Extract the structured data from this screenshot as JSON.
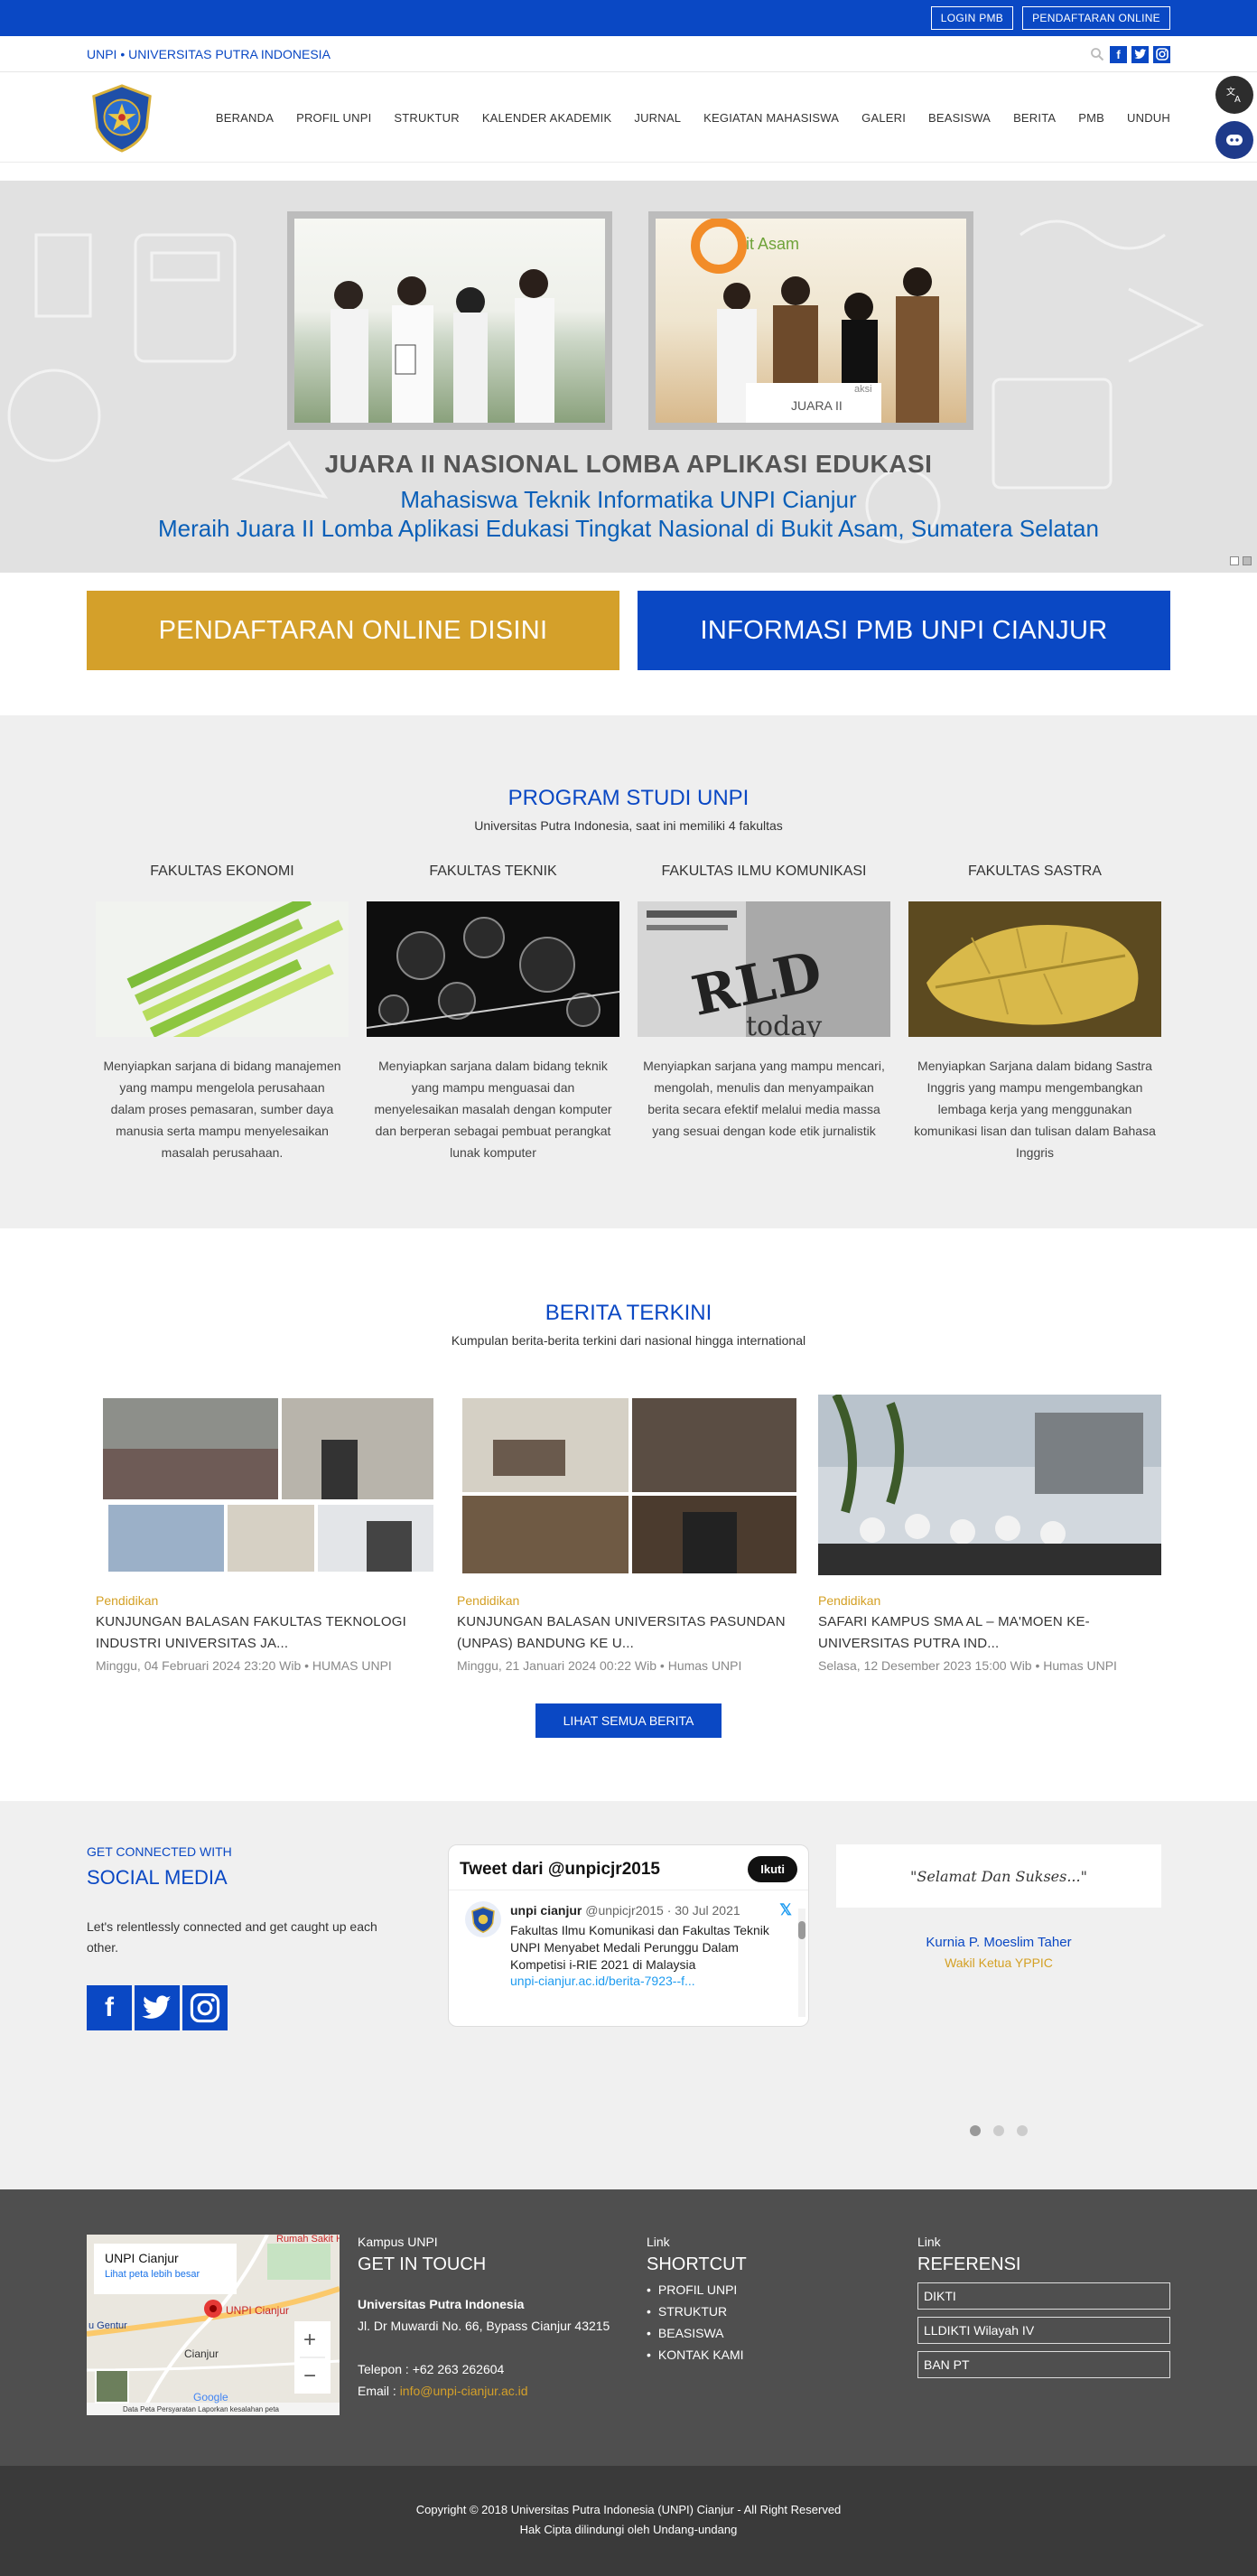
{
  "topbar": {
    "login_label": "LOGIN PMB",
    "register_label": "PENDAFTARAN ONLINE"
  },
  "subheader": {
    "site_tag": "UNPI • UNIVERSITAS PUTRA INDONESIA"
  },
  "nav": {
    "items": [
      "BERANDA",
      "PROFIL UNPI",
      "STRUKTUR",
      "KALENDER AKADEMIK",
      "JURNAL",
      "KEGIATAN MAHASISWA",
      "GALERI",
      "BEASISWA",
      "BERITA",
      "PMB",
      "UNDUH"
    ]
  },
  "hero": {
    "title": "JUARA II NASIONAL LOMBA APLIKASI EDUKASI",
    "line1": "Mahasiswa Teknik Informatika UNPI Cianjur",
    "line2": "Meraih Juara II Lomba Aplikasi Edukasi Tingkat Nasional di Bukit Asam, Sumatera Selatan",
    "banner_text": "JUARA II",
    "banner_brand": "aksi",
    "backdrop_text": "it Asam"
  },
  "cta": {
    "left_label": "PENDAFTARAN ONLINE DISINI",
    "right_label": "INFORMASI PMB UNPI CIANJUR",
    "left_color": "#d4a02a",
    "right_color": "#0a48c4"
  },
  "prodi": {
    "title": "PROGRAM STUDI UNPI",
    "subtitle": "Universitas Putra Indonesia, saat ini memiliki 4 fakultas",
    "faculties": [
      {
        "name": "FAKULTAS EKONOMI",
        "desc": "Menyiapkan sarjana di bidang manajemen yang mampu mengelola perusahaan dalam proses pemasaran, sumber daya manusia serta mampu menyelesaikan masalah perusahaan."
      },
      {
        "name": "FAKULTAS TEKNIK",
        "desc": "Menyiapkan sarjana dalam bidang teknik yang mampu menguasai dan menyelesaikan masalah dengan komputer dan berperan sebagai pembuat perangkat lunak komputer"
      },
      {
        "name": "FAKULTAS ILMU KOMUNIKASI",
        "desc": "Menyiapkan sarjana yang mampu mencari, mengolah, menulis dan menyampaikan berita secara efektif melalui media massa yang sesuai dengan kode etik jurnalistik",
        "image_text": "today"
      },
      {
        "name": "FAKULTAS SASTRA",
        "desc": "Menyiapkan Sarjana dalam bidang Sastra Inggris yang mampu mengembangkan lembaga kerja yang menggunakan komunikasi lisan dan tulisan dalam Bahasa Inggris"
      }
    ]
  },
  "berita": {
    "title": "BERITA TERKINI",
    "subtitle": "Kumpulan berita-berita terkini dari nasional hingga international",
    "items": [
      {
        "category": "Pendidikan",
        "title": "KUNJUNGAN BALASAN FAKULTAS TEKNOLOGI INDUSTRI UNIVERSITAS JA...",
        "meta": "Minggu, 04 Februari 2024 23:20 Wib • HUMAS UNPI"
      },
      {
        "category": "Pendidikan",
        "title": "KUNJUNGAN BALASAN UNIVERSITAS PASUNDAN (UNPAS) BANDUNG KE U...",
        "meta": "Minggu, 21 Januari 2024 00:22 Wib • Humas UNPI"
      },
      {
        "category": "Pendidikan",
        "title": "SAFARI KAMPUS SMA AL – MA'MOEN KE-UNIVERSITAS PUTRA IND...",
        "meta": "Selasa, 12 Desember 2023 15:00 Wib • Humas UNPI"
      }
    ],
    "all_label": "LIHAT SEMUA BERITA"
  },
  "social": {
    "kicker": "GET CONNECTED WITH",
    "title": "SOCIAL MEDIA",
    "text": "Let's relentlessly connected and get caught up each other.",
    "tweet": {
      "header": "Tweet dari @unpicjr2015",
      "follow": "Ikuti",
      "name": "unpi cianjur",
      "handle": "@unpicjr2015 · 30 Jul 2021",
      "text": "Fakultas Ilmu Komunikasi dan Fakultas Teknik UNPI Menyabet Medali Perunggu Dalam Kompetisi i-RIE 2021 di Malaysia",
      "link": "unpi-cianjur.ac.id/berita-7923--f..."
    },
    "quote": "\"Selamat Dan Sukses...\"",
    "quote_name": "Kurnia P. Moeslim Taher",
    "quote_role": "Wakil Ketua YPPIC"
  },
  "footer": {
    "map": {
      "title": "UNPI Cianjur",
      "link": "Lihat peta lebih besar",
      "pin_label": "UNPI Cianjur",
      "place1": "Cianjur",
      "place2": "Rumah Sakit Hafiz Ci...",
      "place3": "u Gentur",
      "attribution": "Data Peta   Persyaratan   Laporkan kesalahan peta",
      "zoom_in": "+",
      "zoom_out": "−",
      "brand": "Google"
    },
    "contact": {
      "kicker": "Kampus UNPI",
      "title": "GET IN TOUCH",
      "name": "Universitas Putra Indonesia",
      "address": "Jl. Dr Muwardi No. 66, Bypass Cianjur 43215",
      "phone": "Telepon : +62 263 262604",
      "email_label": "Email : ",
      "email": "info@unpi-cianjur.ac.id"
    },
    "shortcut": {
      "kicker": "Link",
      "title": "SHORTCUT",
      "items": [
        "PROFIL UNPI",
        "STRUKTUR",
        "BEASISWA",
        "KONTAK KAMI"
      ]
    },
    "referensi": {
      "kicker": "Link",
      "title": "REFERENSI",
      "items": [
        "DIKTI",
        "LLDIKTI Wilayah IV",
        "BAN PT"
      ]
    }
  },
  "copyright": {
    "line1": "Copyright © 2018 Universitas Putra Indonesia (UNPI) Cianjur - All Right Reserved",
    "line2": "Hak Cipta dilindungi oleh Undang-undang"
  }
}
